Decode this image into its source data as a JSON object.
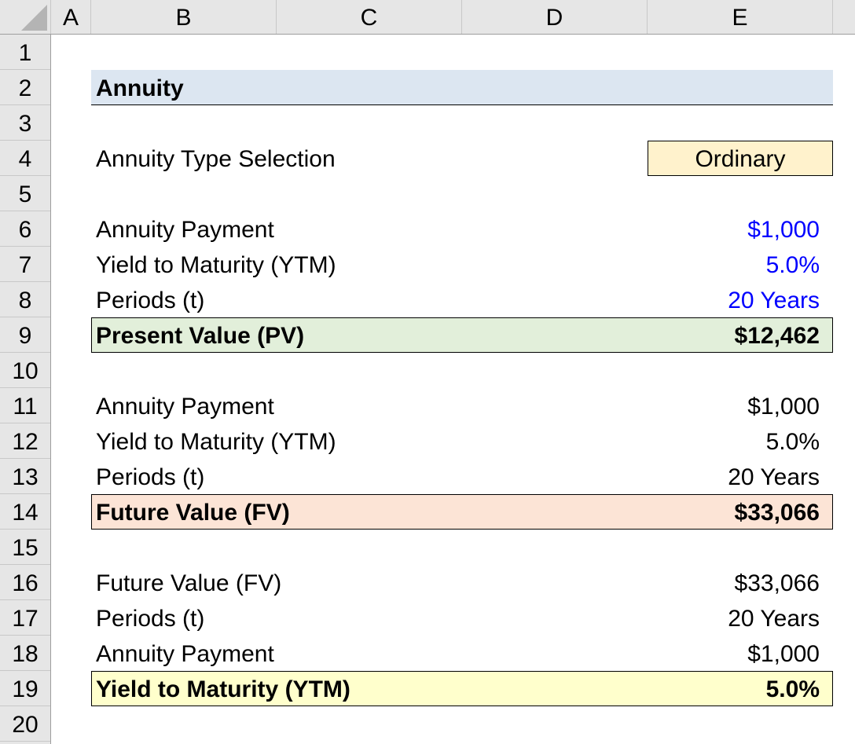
{
  "columns": [
    "A",
    "B",
    "C",
    "D",
    "E"
  ],
  "rows": [
    "1",
    "2",
    "3",
    "4",
    "5",
    "6",
    "7",
    "8",
    "9",
    "10",
    "11",
    "12",
    "13",
    "14",
    "15",
    "16",
    "17",
    "18",
    "19",
    "20"
  ],
  "title": "Annuity",
  "annuity_type": {
    "label": "Annuity Type Selection",
    "value": "Ordinary"
  },
  "pv_section": {
    "inputs": [
      {
        "label": "Annuity Payment",
        "value": "$1,000"
      },
      {
        "label": "Yield to Maturity (YTM)",
        "value": "5.0%"
      },
      {
        "label": "Periods (t)",
        "value": "20 Years"
      }
    ],
    "result": {
      "label": "Present Value (PV)",
      "value": "$12,462"
    }
  },
  "fv_section": {
    "inputs": [
      {
        "label": "Annuity Payment",
        "value": "$1,000"
      },
      {
        "label": "Yield to Maturity (YTM)",
        "value": "5.0%"
      },
      {
        "label": "Periods (t)",
        "value": "20 Years"
      }
    ],
    "result": {
      "label": "Future Value (FV)",
      "value": "$33,066"
    }
  },
  "ytm_section": {
    "inputs": [
      {
        "label": "Future Value (FV)",
        "value": "$33,066"
      },
      {
        "label": "Periods (t)",
        "value": "20 Years"
      },
      {
        "label": "Annuity Payment",
        "value": "$1,000"
      }
    ],
    "result": {
      "label": "Yield to Maturity (YTM)",
      "value": "5.0%"
    }
  },
  "colors": {
    "input_font": "#0000ff",
    "title_fill": "#dce6f1",
    "dropdown_fill": "#fff2cc",
    "pv_fill": "#e2efda",
    "fv_fill": "#fce4d6",
    "ytm_fill": "#ffffcc"
  }
}
